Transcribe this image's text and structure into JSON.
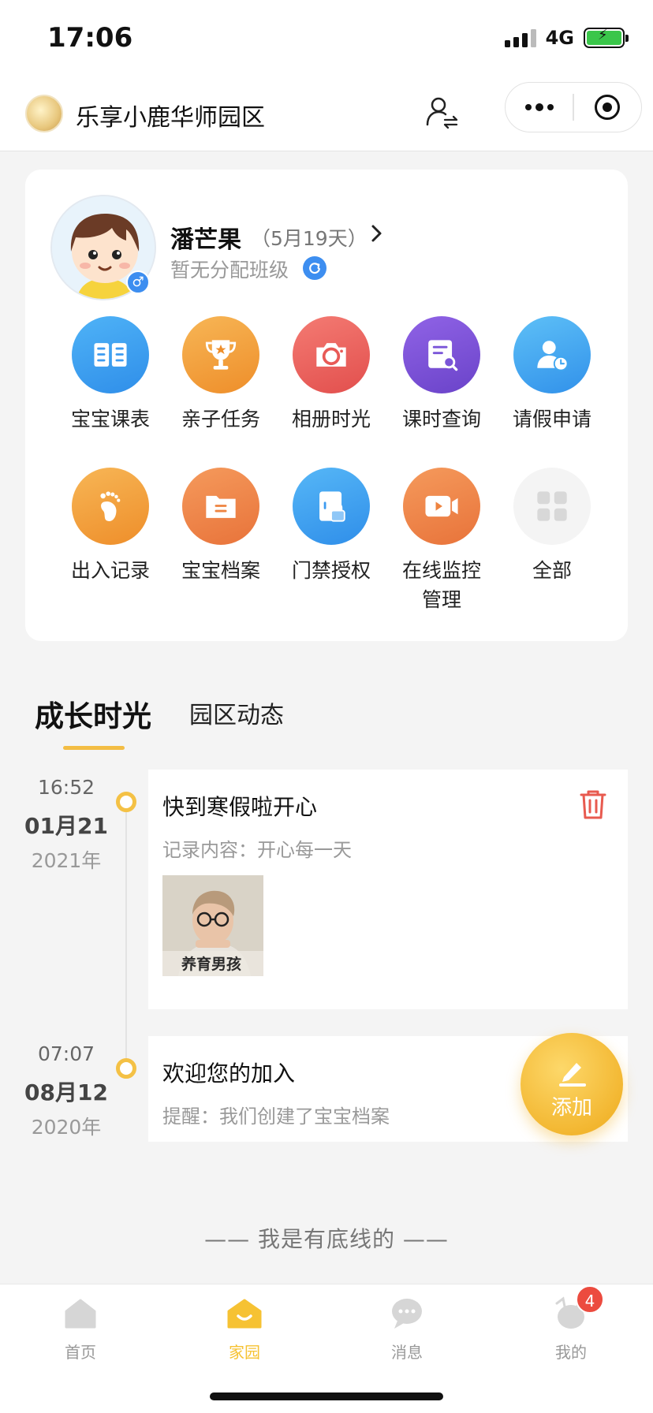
{
  "status_bar": {
    "time": "17:06",
    "network": "4G"
  },
  "nav": {
    "title": "乐享小鹿华师园区"
  },
  "profile": {
    "name": "潘芒果",
    "age_text": "（5月19天）",
    "class_status": "暂无分配班级"
  },
  "grid": [
    {
      "label": "宝宝课表",
      "icon": "book-icon",
      "color": "#3d9bf0"
    },
    {
      "label": "亲子任务",
      "icon": "trophy-icon",
      "color": "#f0992c"
    },
    {
      "label": "相册时光",
      "icon": "camera-icon",
      "color": "#ea5956"
    },
    {
      "label": "课时查询",
      "icon": "search-doc-icon",
      "color": "#7a55d8"
    },
    {
      "label": "请假申请",
      "icon": "user-clock-icon",
      "color": "#3fa6f0"
    },
    {
      "label": "出入记录",
      "icon": "footprint-icon",
      "color": "#f0992c"
    },
    {
      "label": "宝宝档案",
      "icon": "folder-icon",
      "color": "#ee8440"
    },
    {
      "label": "门禁授权",
      "icon": "door-lock-icon",
      "color": "#3d9bf0"
    },
    {
      "label": "在线监控\n管理",
      "icon": "video-icon",
      "color": "#ee8440"
    },
    {
      "label": "全部",
      "icon": "grid-icon",
      "color": "#f4f4f4"
    }
  ],
  "tabs": {
    "active": "成长时光",
    "inactive": "园区动态"
  },
  "timeline": [
    {
      "time": "16:52",
      "date": "01月21",
      "year": "2021年",
      "title": "快到寒假啦开心",
      "content": "记录内容：开心每一天",
      "photo_caption": "养育男孩"
    },
    {
      "time": "07:07",
      "date": "08月12",
      "year": "2020年",
      "title": "欢迎您的加入",
      "content": "提醒：我们创建了宝宝档案"
    }
  ],
  "fab": {
    "label": "添加"
  },
  "bottom_line": "—— 我是有底线的 ——",
  "tab_bar": {
    "items": [
      {
        "label": "首页",
        "icon": "home-icon",
        "active": false
      },
      {
        "label": "家园",
        "icon": "family-icon",
        "active": true
      },
      {
        "label": "消息",
        "icon": "chat-icon",
        "active": false
      },
      {
        "label": "我的",
        "icon": "profile-icon",
        "active": false
      }
    ],
    "badge": "4"
  },
  "colors": {
    "accent": "#f4c145",
    "delete": "#e85a4f",
    "badge": "#ec4b3f"
  }
}
